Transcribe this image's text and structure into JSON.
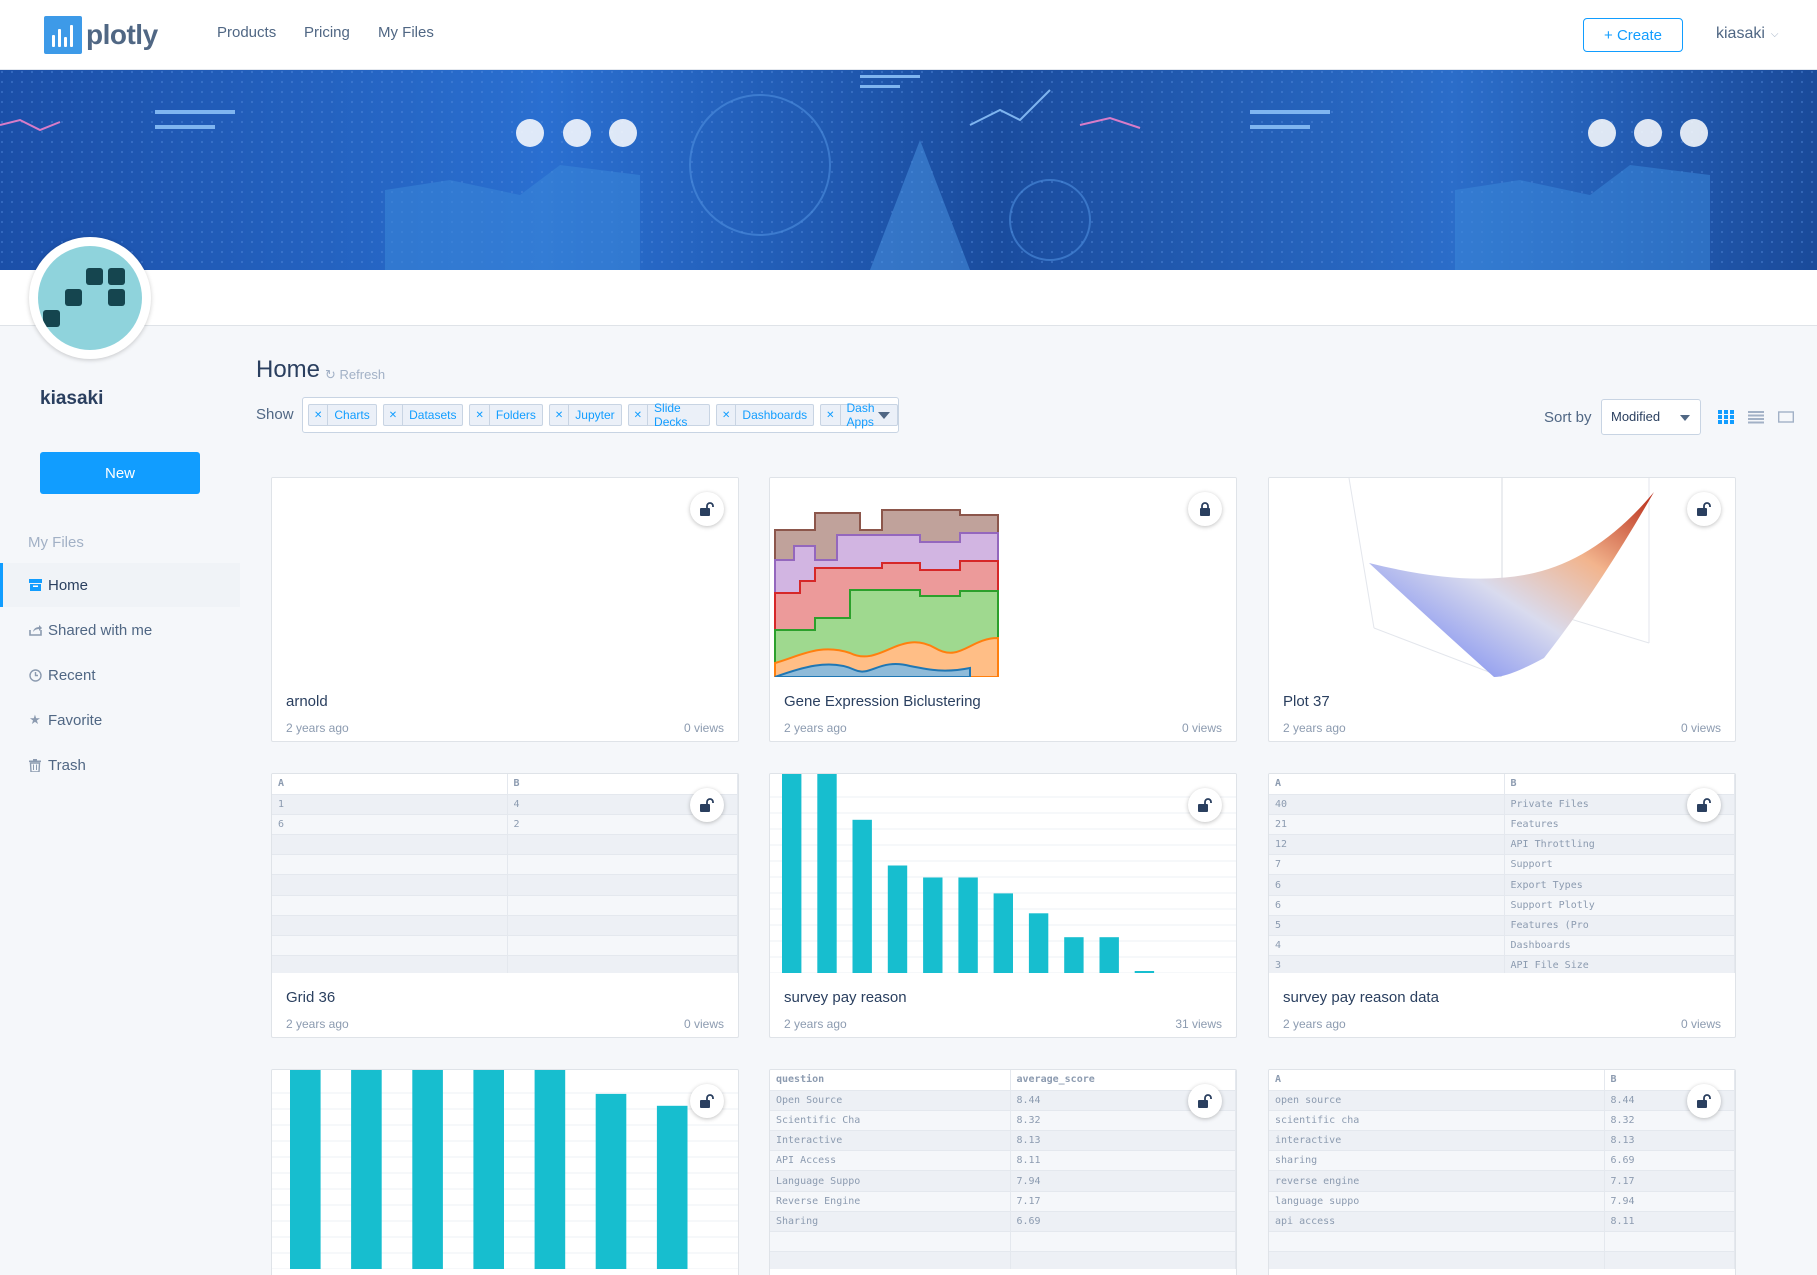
{
  "brand": {
    "logo_text": "plotly"
  },
  "nav": {
    "links": [
      "Products",
      "Pricing",
      "My Files"
    ],
    "create_label": "+ Create",
    "username": "kiasaki"
  },
  "profile": {
    "username": "kiasaki",
    "new_label": "New"
  },
  "sidebar": {
    "heading": "My Files",
    "items": [
      {
        "label": "Home",
        "icon": "archive-icon",
        "active": true
      },
      {
        "label": "Shared with me",
        "icon": "share-icon",
        "active": false
      },
      {
        "label": "Recent",
        "icon": "clock-icon",
        "active": false
      },
      {
        "label": "Favorite",
        "icon": "star-icon",
        "active": false
      },
      {
        "label": "Trash",
        "icon": "trash-icon",
        "active": false
      }
    ]
  },
  "content": {
    "title": "Home",
    "refresh_label": "Refresh",
    "show_label": "Show",
    "filters": [
      "Charts",
      "Datasets",
      "Folders",
      "Jupyter",
      "Slide Decks",
      "Dashboards",
      "Dash Apps"
    ],
    "sort_label": "Sort by",
    "sort_value": "Modified",
    "view_modes": [
      "grid-view-icon",
      "list-view-icon",
      "single-view-icon"
    ]
  },
  "cards": [
    {
      "title": "arnold",
      "date": "2 years ago",
      "views": "0 views",
      "locked": false,
      "thumb": "blank"
    },
    {
      "title": "Gene Expression Biclustering",
      "date": "2 years ago",
      "views": "0 views",
      "locked": true,
      "thumb": "stacked-area"
    },
    {
      "title": "Plot 37",
      "date": "2 years ago",
      "views": "0 views",
      "locked": false,
      "thumb": "surface-3d"
    },
    {
      "title": "Grid 36",
      "date": "2 years ago",
      "views": "0 views",
      "locked": false,
      "thumb": "grid",
      "grid": {
        "headers": [
          "A",
          "B"
        ],
        "rows": [
          [
            "1",
            "4"
          ],
          [
            "6",
            "2"
          ]
        ]
      }
    },
    {
      "title": "survey pay reason",
      "date": "2 years ago",
      "views": "31 views",
      "locked": false,
      "thumb": "bar",
      "bars": [
        100,
        100,
        77,
        54,
        48,
        48,
        40,
        30,
        18,
        18,
        1
      ]
    },
    {
      "title": "survey pay reason data",
      "date": "2 years ago",
      "views": "0 views",
      "locked": false,
      "thumb": "grid",
      "grid": {
        "headers": [
          "A",
          "B"
        ],
        "rows": [
          [
            "40",
            "Private Files"
          ],
          [
            "21",
            "Features"
          ],
          [
            "12",
            "API Throttling"
          ],
          [
            "7",
            "Support"
          ],
          [
            "6",
            "Export Types"
          ],
          [
            "6",
            "Support Plotly"
          ],
          [
            "5",
            "Features (Pro"
          ],
          [
            "4",
            "Dashboards"
          ],
          [
            "3",
            "API File Size"
          ]
        ]
      }
    },
    {
      "title": "",
      "date": "",
      "views": "",
      "locked": false,
      "thumb": "bar",
      "bars": [
        100,
        100,
        100,
        100,
        100,
        88,
        82
      ]
    },
    {
      "title": "",
      "date": "",
      "views": "",
      "locked": false,
      "thumb": "grid",
      "grid": {
        "headers": [
          "question",
          "average_score"
        ],
        "rows": [
          [
            "Open Source",
            "8.44"
          ],
          [
            "Scientific Cha",
            "8.32"
          ],
          [
            "Interactive",
            "8.13"
          ],
          [
            "API Access",
            "8.11"
          ],
          [
            "Language Suppo",
            "7.94"
          ],
          [
            "Reverse Engine",
            "7.17"
          ],
          [
            "Sharing",
            "6.69"
          ]
        ]
      }
    },
    {
      "title": "",
      "date": "",
      "views": "",
      "locked": false,
      "thumb": "grid",
      "grid": {
        "headers": [
          "A",
          "B"
        ],
        "rows": [
          [
            "open source",
            "8.44"
          ],
          [
            "scientific cha",
            "8.32"
          ],
          [
            "interactive",
            "8.13"
          ],
          [
            "sharing",
            "6.69"
          ],
          [
            "reverse engine",
            "7.17"
          ],
          [
            "language suppo",
            "7.94"
          ],
          [
            "api access",
            "8.11"
          ]
        ]
      }
    }
  ],
  "colors": {
    "accent": "#119dff",
    "bar": "#17becf",
    "text": "#2a3f5f"
  }
}
